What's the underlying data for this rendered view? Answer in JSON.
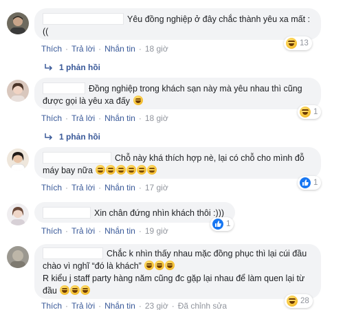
{
  "comments": [
    {
      "text": "Yêu đồng nghiệp ở đây chắc thành yêu xa mất :((",
      "actions": {
        "like": "Thích",
        "reply": "Trả lời",
        "message": "Nhắn tin",
        "time": "18 giờ"
      },
      "reaction": {
        "type": "haha",
        "count": "13"
      },
      "replies": "1 phản hồi"
    },
    {
      "text": "Đồng nghiệp trong khách sạn này mà yêu nhau thì cũng được gọi là yêu xa đấy",
      "actions": {
        "like": "Thích",
        "reply": "Trả lời",
        "message": "Nhắn tin",
        "time": "18 giờ"
      },
      "reaction": {
        "type": "haha",
        "count": "1"
      },
      "replies": "1 phản hồi"
    },
    {
      "text": "Chỗ này khá thích hợp nè, lại có chỗ cho mình đỗ máy bay nữa",
      "actions": {
        "like": "Thích",
        "reply": "Trả lời",
        "message": "Nhắn tin",
        "time": "17 giờ"
      },
      "reaction": {
        "type": "like",
        "count": "1"
      }
    },
    {
      "text": "Xin chân đứng nhìn khách thôi :)))",
      "actions": {
        "like": "Thích",
        "reply": "Trả lời",
        "message": "Nhắn tin",
        "time": "19 giờ"
      },
      "reaction": {
        "type": "like",
        "count": "1"
      }
    },
    {
      "text_line1": "Chắc k nhìn thấy nhau mặc đồng phục thì lại cúi đầu chào vì nghĩ “đó là khách”",
      "text_line2": "R kiểu j staff party hàng năm cũng đc gặp lại nhau để làm quen lại từ đầu",
      "actions": {
        "like": "Thích",
        "reply": "Trả lời",
        "message": "Nhắn tin",
        "time": "23 giờ",
        "edited": "Đã chỉnh sửa"
      },
      "reaction": {
        "type": "haha",
        "count": "28"
      }
    }
  ],
  "colors": {
    "link": "#385898",
    "bubble": "#f2f3f5",
    "meta": "#90949c",
    "like_blue": "#1877f2"
  }
}
